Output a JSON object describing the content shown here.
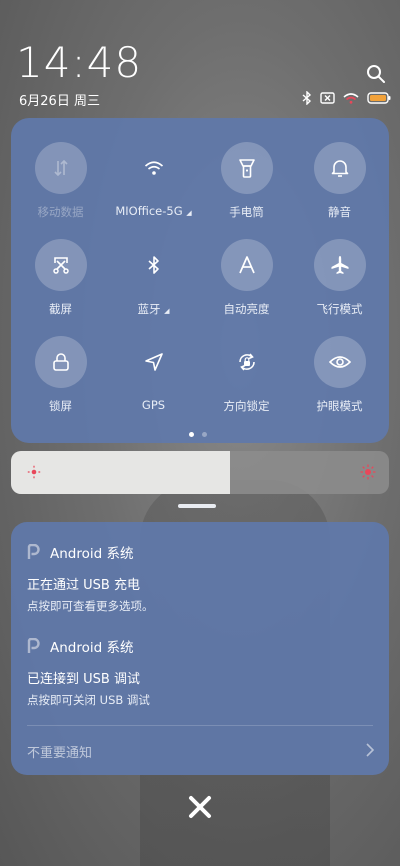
{
  "status": {
    "time": "14:48",
    "date": "6月26日 周三",
    "icons": [
      "bluetooth-icon",
      "no-sim-icon",
      "wifi-icon",
      "battery-icon"
    ]
  },
  "quick_settings": {
    "tiles": [
      {
        "name": "mobile-data",
        "label": "移动数据",
        "icon": "data-arrows-icon",
        "state": "disabled"
      },
      {
        "name": "wifi",
        "label": "MIOffice-5G",
        "icon": "wifi-icon",
        "state": "on",
        "has_caret": true
      },
      {
        "name": "flashlight",
        "label": "手电筒",
        "icon": "flashlight-icon",
        "state": "off"
      },
      {
        "name": "mute",
        "label": "静音",
        "icon": "bell-icon",
        "state": "off"
      },
      {
        "name": "screenshot",
        "label": "截屏",
        "icon": "scissors-icon",
        "state": "off"
      },
      {
        "name": "bluetooth",
        "label": "蓝牙",
        "icon": "bluetooth-icon",
        "state": "on",
        "has_caret": true
      },
      {
        "name": "auto-brightness",
        "label": "自动亮度",
        "icon": "letter-a-icon",
        "state": "off"
      },
      {
        "name": "airplane-mode",
        "label": "飞行模式",
        "icon": "airplane-icon",
        "state": "off"
      },
      {
        "name": "lock-screen",
        "label": "锁屏",
        "icon": "lock-icon",
        "state": "off"
      },
      {
        "name": "gps",
        "label": "GPS",
        "icon": "navigation-arrow-icon",
        "state": "on"
      },
      {
        "name": "rotation-lock",
        "label": "方向锁定",
        "icon": "rotation-lock-icon",
        "state": "on"
      },
      {
        "name": "eye-care",
        "label": "护眼模式",
        "icon": "eye-icon",
        "state": "off"
      }
    ],
    "page_count": 2,
    "active_page": 1
  },
  "brightness": {
    "level": 0.58,
    "accent_color": "#e8475a"
  },
  "notifications": [
    {
      "app": "Android 系统",
      "title": "正在通过 USB 充电",
      "body": "点按即可查看更多选项。"
    },
    {
      "app": "Android 系统",
      "title": "已连接到 USB 调试",
      "body": "点按即可关闭 USB 调试"
    }
  ],
  "unimportant_label": "不重要通知",
  "colors": {
    "panel": "#6078aa",
    "tile_off": "rgba(255,255,255,0.22)"
  }
}
